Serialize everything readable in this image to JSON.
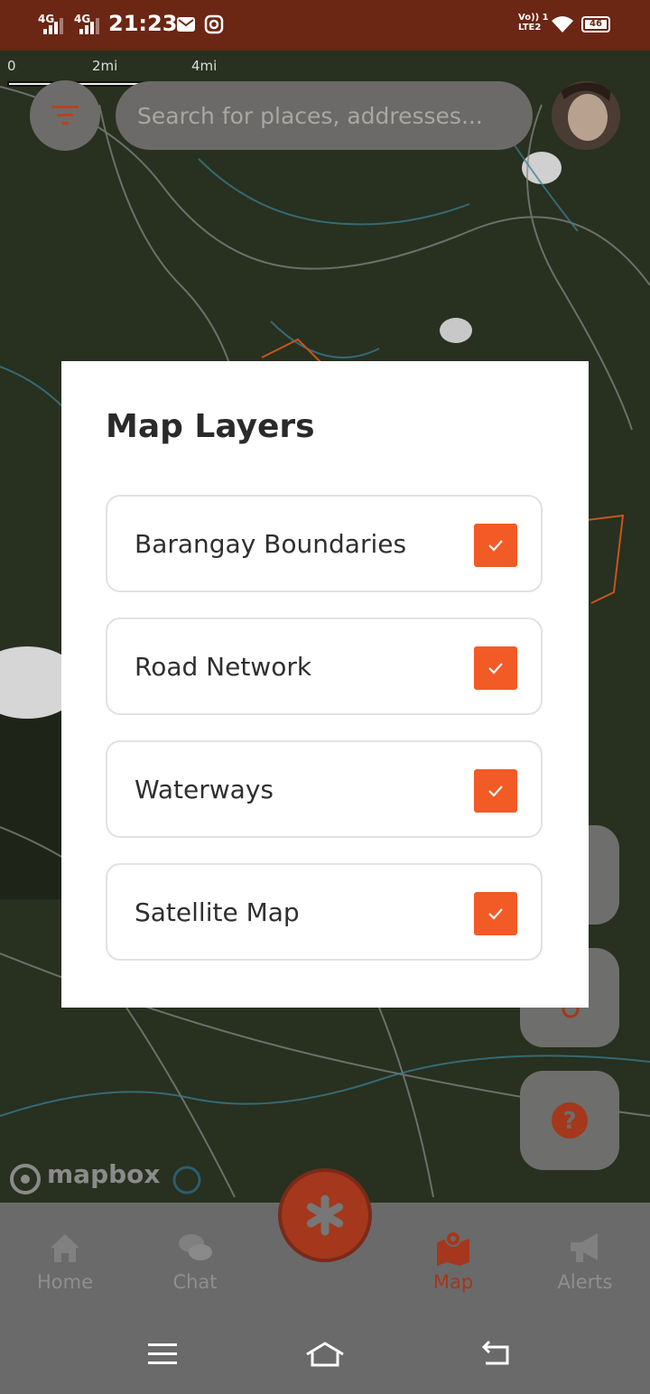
{
  "status_bar": {
    "network_1": "4G",
    "network_2": "4G",
    "time": "21:23",
    "carrier_label_top": "Vo)) 1",
    "carrier_label_bottom": "LTE2",
    "battery": "46",
    "icons": [
      "signal-icon",
      "signal-icon",
      "mail-icon",
      "instagram-icon",
      "wifi-icon",
      "battery-icon"
    ]
  },
  "map": {
    "scale_labels": [
      "0",
      "2mi",
      "4mi"
    ],
    "search_placeholder": "Search for places, addresses...",
    "attribution": "mapbox",
    "side_buttons": [
      "layers-icon",
      "location-icon",
      "help-icon"
    ]
  },
  "dialog": {
    "title": "Map Layers",
    "layers": [
      {
        "label": "Barangay Boundaries",
        "checked": true
      },
      {
        "label": "Road Network",
        "checked": true
      },
      {
        "label": "Waterways",
        "checked": true
      },
      {
        "label": "Satellite Map",
        "checked": true
      }
    ]
  },
  "bottom_nav": {
    "items": [
      {
        "label": "Home",
        "icon": "home-icon",
        "active": false
      },
      {
        "label": "Chat",
        "icon": "chat-icon",
        "active": false
      },
      {
        "label": "Map",
        "icon": "map-icon",
        "active": true
      },
      {
        "label": "Alerts",
        "icon": "megaphone-icon",
        "active": false
      }
    ],
    "center_button_icon": "asterisk-icon"
  },
  "colors": {
    "status_bar_bg": "#6b2614",
    "accent": "#f25a26",
    "active_nav": "#a4371c",
    "nav_bg": "#6a6a6a"
  },
  "system_nav": [
    "menu-icon",
    "home-nav-icon",
    "back-icon"
  ]
}
